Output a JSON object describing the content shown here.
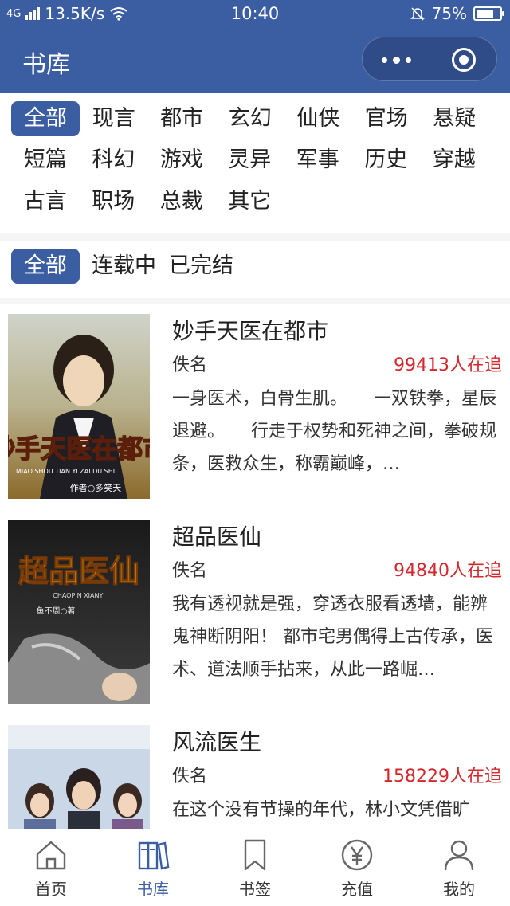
{
  "status_bar": {
    "network": "4G",
    "speed": "13.5K/s",
    "time": "10:40",
    "battery": "75%",
    "battery_level": 0.75
  },
  "nav": {
    "title": "书库",
    "more_icon": "more-dots-icon",
    "close_icon": "close-miniapp-icon"
  },
  "categories": [
    "全部",
    "现言",
    "都市",
    "玄幻",
    "仙侠",
    "官场",
    "悬疑",
    "短篇",
    "科幻",
    "游戏",
    "灵异",
    "军事",
    "历史",
    "穿越",
    "古言",
    "职场",
    "总裁",
    "其它"
  ],
  "status_filters": [
    "全部",
    "连载中",
    "已完结"
  ],
  "books": [
    {
      "title": "妙手天医在都市",
      "author": "佚名",
      "followers": "99413人在追",
      "intro": "一身医术，白骨生肌。　　一双铁拳，星辰退避。　　行走于权势和死神之间，拳破规条，医救众生，称霸巅峰，…",
      "cover_title": "妙手天医在都市",
      "cover_pinyin": "MIAO SHOU TIAN YI ZAI DU SHI",
      "cover_author": "作者○多笑天"
    },
    {
      "title": "超品医仙",
      "author": "佚名",
      "followers": "94840人在追",
      "intro": "我有透视就是强，穿透衣服看透墙，能辨鬼神断阴阳！ 都市宅男偶得上古传承，医术、道法顺手拈来，从此一路崛…",
      "cover_title": "超品医仙",
      "cover_pinyin": "CHAOPIN XIANYI",
      "cover_author": "鱼不周○著"
    },
    {
      "title": "风流医生",
      "author": "佚名",
      "followers": "158229人在追",
      "intro": "在这个没有节操的年代，林小文凭借旷",
      "cover_title": "",
      "cover_pinyin": "",
      "cover_author": ""
    }
  ],
  "tabbar": [
    {
      "label": "首页",
      "icon": "home-icon"
    },
    {
      "label": "书库",
      "icon": "library-icon"
    },
    {
      "label": "书签",
      "icon": "bookmark-icon"
    },
    {
      "label": "充值",
      "icon": "yen-icon"
    },
    {
      "label": "我的",
      "icon": "user-icon"
    }
  ],
  "colors": {
    "brand": "#3b5ea3",
    "follow_count": "#d4262b"
  }
}
